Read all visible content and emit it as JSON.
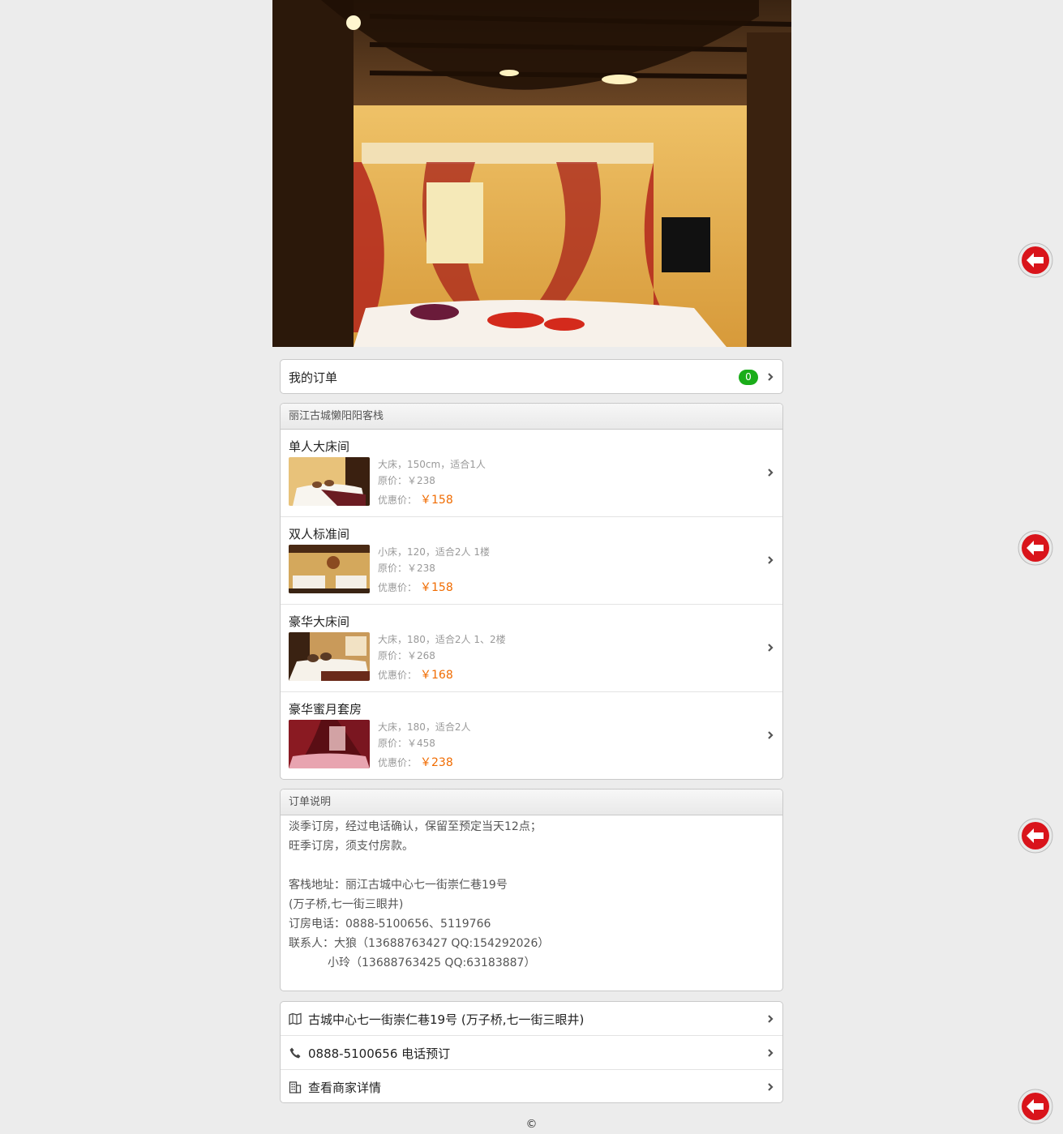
{
  "my_orders": {
    "label": "我的订单",
    "count": "0"
  },
  "hotel": {
    "name": "丽江古城懒阳阳客栈",
    "rooms": [
      {
        "name": "单人大床间",
        "desc": "大床，150cm，适合1人",
        "orig_label": "原价：",
        "orig_price": "￥238",
        "disc_label": "优惠价：",
        "disc_price": "￥158"
      },
      {
        "name": "双人标准间",
        "desc": "小床，120，适合2人 1楼",
        "orig_label": "原价：",
        "orig_price": "￥238",
        "disc_label": "优惠价：",
        "disc_price": "￥158"
      },
      {
        "name": "豪华大床间",
        "desc": "大床，180，适合2人 1、2楼",
        "orig_label": "原价：",
        "orig_price": "￥268",
        "disc_label": "优惠价：",
        "disc_price": "￥168"
      },
      {
        "name": "豪华蜜月套房",
        "desc": "大床，180，适合2人",
        "orig_label": "原价：",
        "orig_price": "￥458",
        "disc_label": "优惠价：",
        "disc_price": "￥238"
      }
    ]
  },
  "notes": {
    "title": "订单说明",
    "lines": [
      "淡季订房，经过电话确认，保留至预定当天12点；",
      "旺季订房，须支付房款。",
      "",
      "客栈地址：丽江古城中心七一街崇仁巷19号",
      "(万子桥,七一街三眼井)",
      "订房电话：0888-5100656、5119766",
      "联系人：大狼（13688763427 QQ:154292026）",
      "小玲（13688763425 QQ:63183887）"
    ]
  },
  "links": {
    "address": "古城中心七一街崇仁巷19号 (万子桥,七一街三眼井)",
    "phone": "0888-5100656 电话预订",
    "merchant": "查看商家详情"
  },
  "footer": {
    "copyright": "©"
  },
  "icons": {
    "chevron": "chevron-right-icon",
    "map": "map-icon",
    "phone": "phone-icon",
    "building": "building-icon",
    "back": "back-arrow-icon"
  },
  "colors": {
    "badge": "#1aad19",
    "price": "#f06b00",
    "back_button": "#d9141b"
  }
}
